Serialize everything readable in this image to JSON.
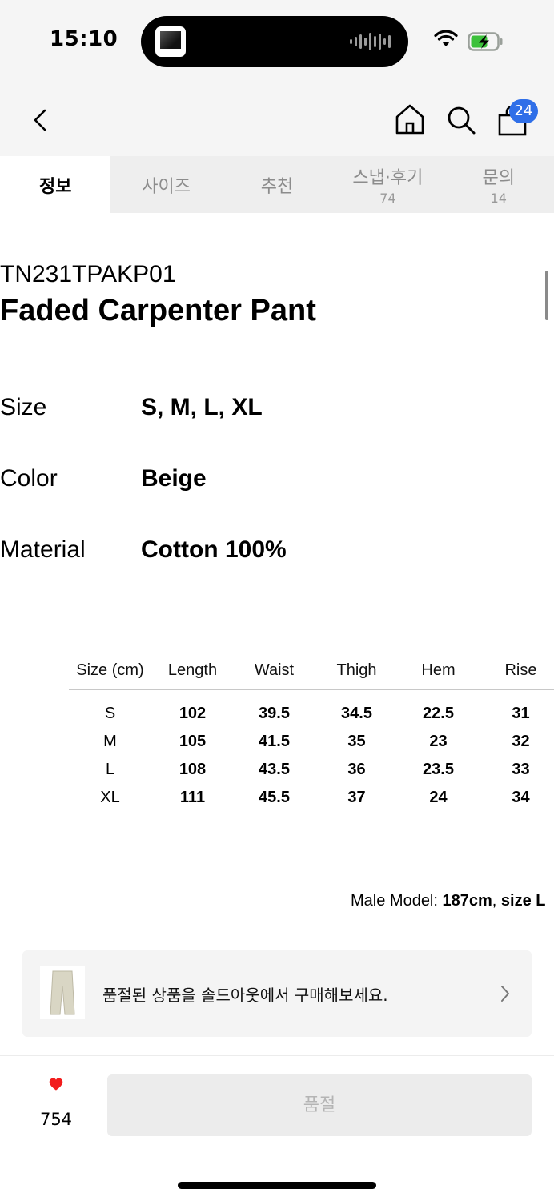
{
  "status": {
    "time": "15:10"
  },
  "header": {
    "cart_count": "24"
  },
  "tabs": [
    {
      "label": "정보",
      "count": ""
    },
    {
      "label": "사이즈",
      "count": ""
    },
    {
      "label": "추천",
      "count": ""
    },
    {
      "label": "스냅·후기",
      "count": "74"
    },
    {
      "label": "문의",
      "count": "14"
    }
  ],
  "product": {
    "code": "TN231TPAKP01",
    "name": "Faded Carpenter Pant"
  },
  "specs": [
    {
      "label": "Size",
      "value": "S, M, L, XL"
    },
    {
      "label": "Color",
      "value": "Beige"
    },
    {
      "label": "Material",
      "value": "Cotton 100%"
    }
  ],
  "size_table": {
    "headers": [
      "Size (cm)",
      "Length",
      "Waist",
      "Thigh",
      "Hem",
      "Rise"
    ],
    "rows": [
      [
        "S",
        "102",
        "39.5",
        "34.5",
        "22.5",
        "31"
      ],
      [
        "M",
        "105",
        "41.5",
        "35",
        "23",
        "32"
      ],
      [
        "L",
        "108",
        "43.5",
        "36",
        "23.5",
        "33"
      ],
      [
        "XL",
        "111",
        "45.5",
        "37",
        "24",
        "34"
      ]
    ]
  },
  "model_note": {
    "prefix": "Male Model: ",
    "height": "187cm",
    "sep": ", ",
    "size": "size L"
  },
  "soldout_banner": {
    "text": "품절된 상품을 솔드아웃에서 구매해보세요."
  },
  "bottom_bar": {
    "like_count": "754",
    "buy_label": "품절"
  },
  "colors": {
    "badge": "#2f6fe8",
    "heart": "#f21c1c",
    "tab_bg": "#eeeeee"
  }
}
